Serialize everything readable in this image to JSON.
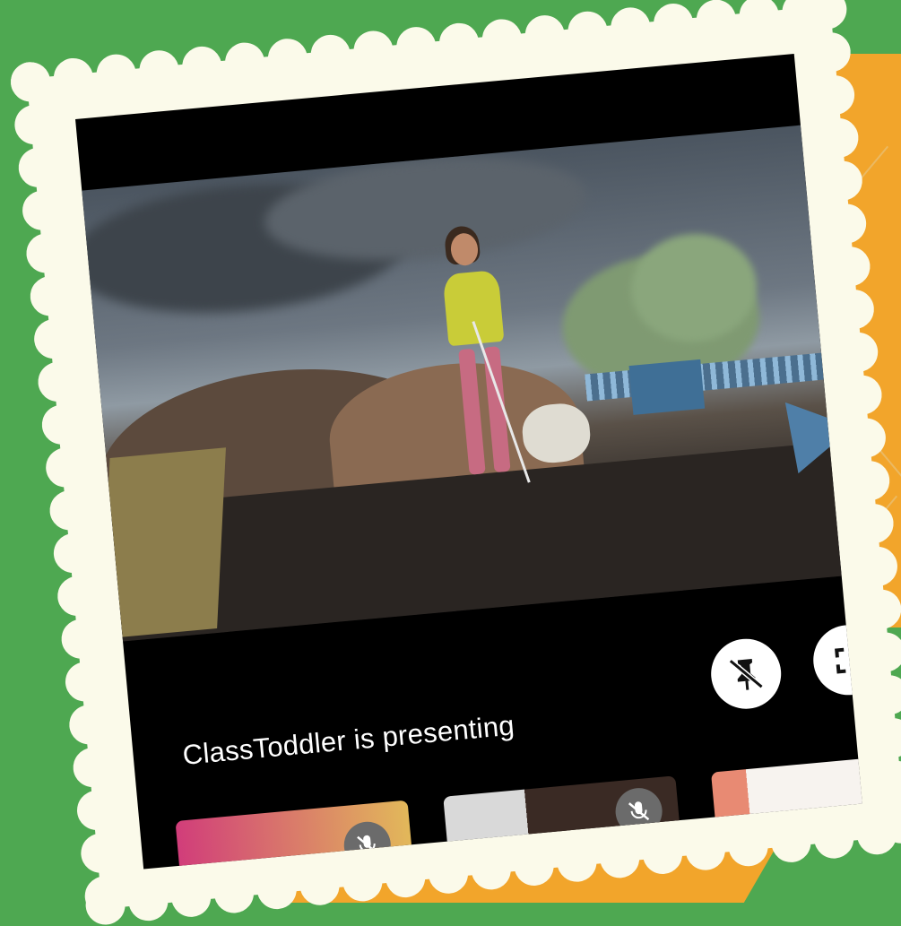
{
  "presenter_text": "ClassToddler is presenting",
  "controls": {
    "pin_icon": "unpin-icon",
    "fullscreen_icon": "fullscreen-icon"
  },
  "participants": [
    {
      "mic_icon": "mic-off-icon"
    },
    {
      "mic_icon": "mic-off-icon"
    },
    {}
  ],
  "colors": {
    "background_green": "#4ea851",
    "accent_orange": "#f2a52b",
    "paper": "#fbfaea",
    "screen": "#000000"
  }
}
